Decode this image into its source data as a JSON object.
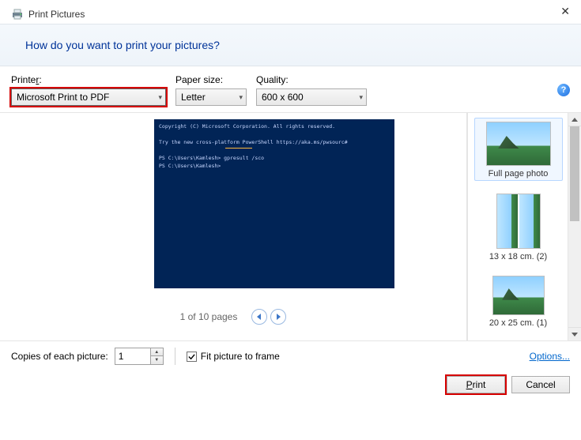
{
  "window": {
    "title": "Print Pictures",
    "heading": "How do you want to print your pictures?"
  },
  "controls": {
    "printer_label": "Printer:",
    "printer_value": "Microsoft Print to PDF",
    "paper_label": "Paper size:",
    "paper_value": "Letter",
    "quality_label": "Quality:",
    "quality_value": "600 x 600"
  },
  "preview": {
    "console_lines": "Copyright (C) Microsoft Corporation. All rights reserved.\n\nTry the new cross-platform PowerShell https://aka.ms/pwsourc#\n\nPS C:\\Users\\Kamlesh> gpresult /sco\nPS C:\\Users\\Kamlesh>",
    "pager": "1 of 10 pages"
  },
  "layouts": [
    {
      "label": "Full page photo"
    },
    {
      "label": "13 x 18 cm. (2)"
    },
    {
      "label": "20 x 25 cm. (1)"
    }
  ],
  "bottom": {
    "copies_label": "Copies of each picture:",
    "copies_value": "1",
    "fit_label": "Fit picture to frame",
    "fit_checked": true,
    "options_link": "Options...",
    "print_btn": "Print",
    "cancel_btn": "Cancel"
  }
}
